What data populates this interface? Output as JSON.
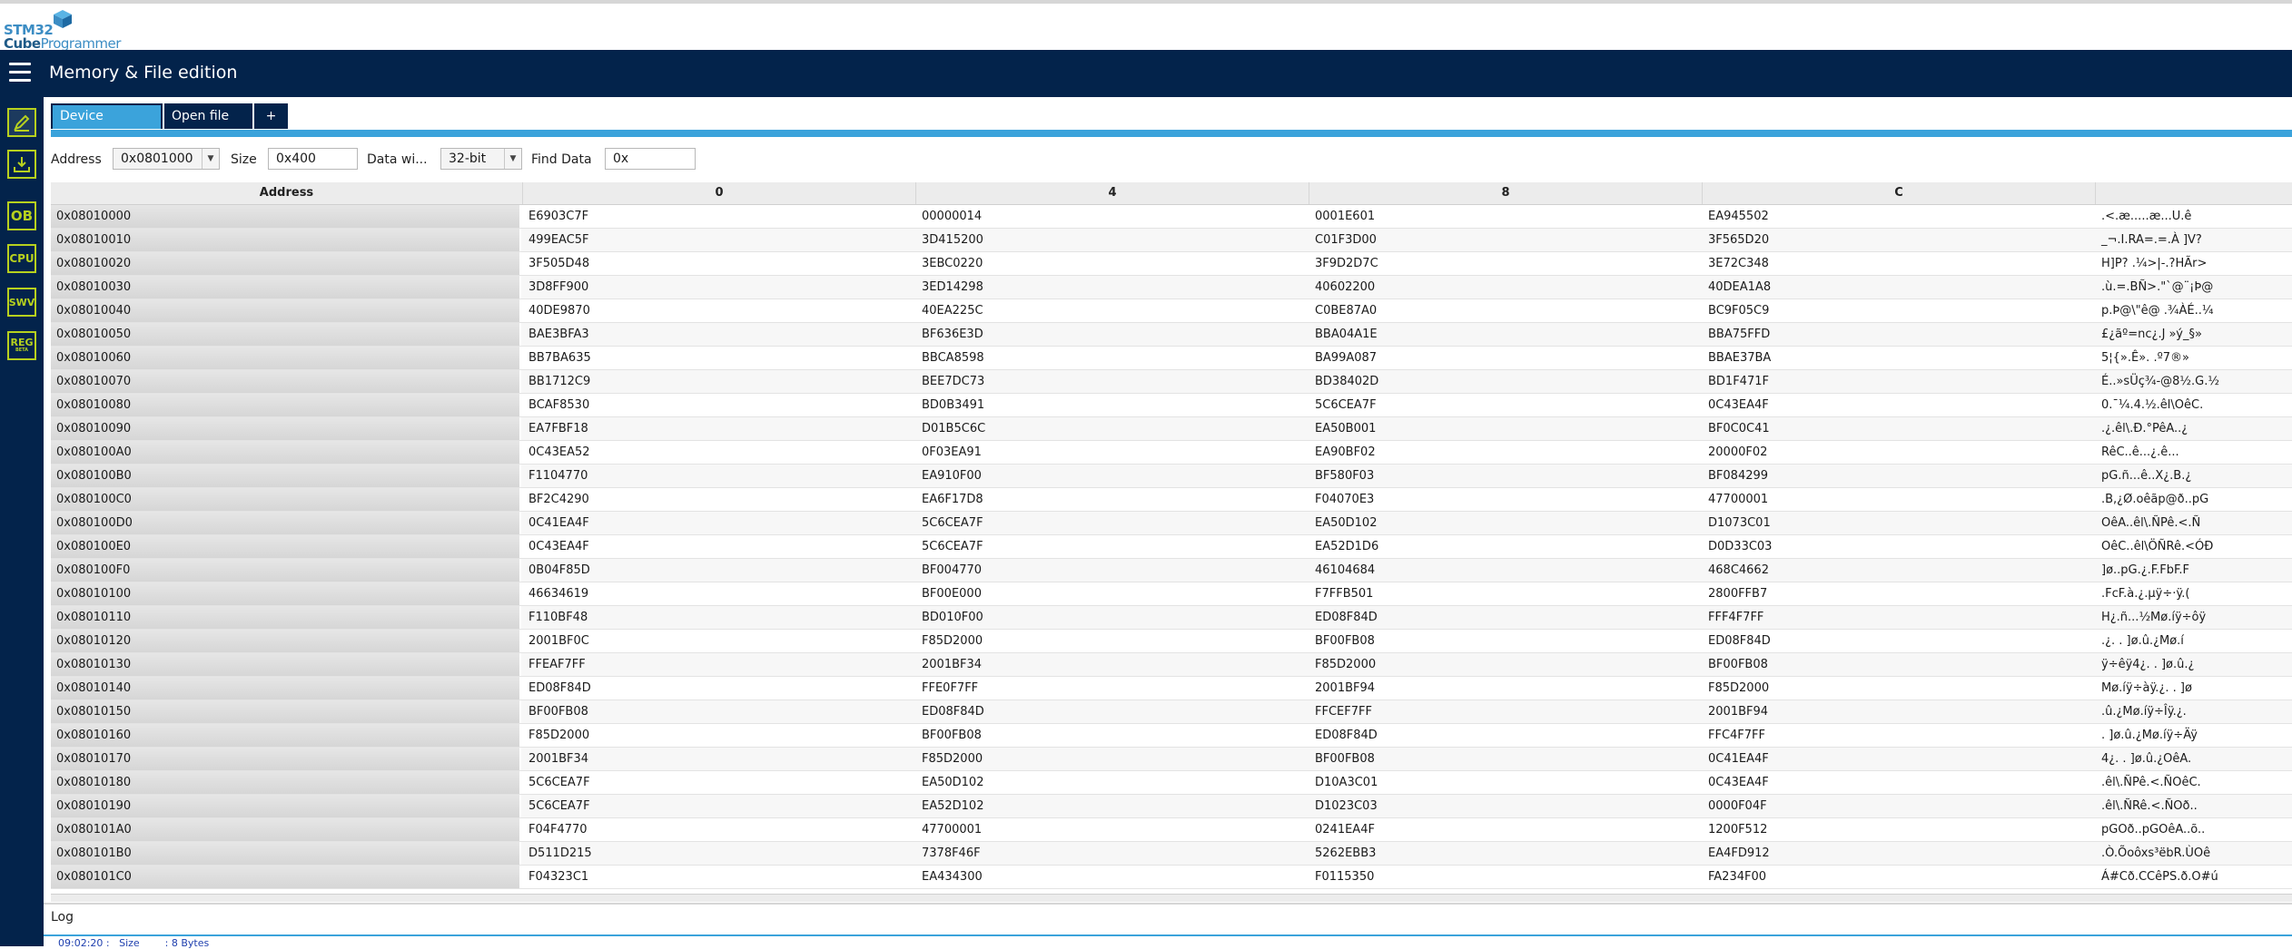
{
  "app": {
    "logo_line1": "STM32",
    "logo_line2_bold": "Cube",
    "logo_line2_rest": "Programmer",
    "page_title": "Memory & File edition"
  },
  "sidebar": [
    {
      "label": "",
      "icon": "pencil-icon"
    },
    {
      "label": "",
      "icon": "download-icon"
    },
    {
      "label": "OB",
      "icon": "option-bytes-icon"
    },
    {
      "label": "CPU",
      "icon": "cpu-icon"
    },
    {
      "label": "SWV",
      "icon": "swv-icon"
    },
    {
      "label": "REG",
      "sub": "BETA",
      "icon": "registers-icon"
    }
  ],
  "tabs": {
    "device_memory": "Device memory",
    "open_file": "Open file",
    "add": "+"
  },
  "toolbar": {
    "address_label": "Address",
    "address_value": "0x0801000",
    "size_label": "Size",
    "size_value": "0x400",
    "data_width_label": "Data wi...",
    "data_width_value": "32-bit",
    "find_label": "Find Data",
    "find_value": "0x"
  },
  "table": {
    "headers": [
      "Address",
      "0",
      "4",
      "8",
      "C",
      ""
    ],
    "rows": [
      [
        "0x08010000",
        "E6903C7F",
        "00000014",
        "0001E601",
        "EA945502",
        ".<.æ.....æ...U.ê"
      ],
      [
        "0x08010010",
        "499EAC5F",
        "3D415200",
        "C01F3D00",
        "3F565D20",
        "_¬.I.RA=.=.À ]V?"
      ],
      [
        "0x08010020",
        "3F505D48",
        "3EBC0220",
        "3F9D2D7C",
        "3E72C348",
        "H]P? .¼>|-.?HÃr>"
      ],
      [
        "0x08010030",
        "3D8FF900",
        "3ED14298",
        "40602200",
        "40DEA1A8",
        ".ù.=.BÑ>.\"`@¨¡Þ@"
      ],
      [
        "0x08010040",
        "40DE9870",
        "40EA225C",
        "C0BE87A0",
        "BC9F05C9",
        "p.Þ@\\\"ê@ .¾ÀÉ..¼"
      ],
      [
        "0x08010050",
        "BAE3BFA3",
        "BF636E3D",
        "BBA04A1E",
        "BBA75FFD",
        "£¿ãº=nc¿.J »ý_§»"
      ],
      [
        "0x08010060",
        "BB7BA635",
        "BBCA8598",
        "BA99A087",
        "BBAE37BA",
        "5¦{».Ê». .º7®»"
      ],
      [
        "0x08010070",
        "BB1712C9",
        "BEE7DC73",
        "BD38402D",
        "BD1F471F",
        "É..»sÜç¾-@8½.G.½"
      ],
      [
        "0x08010080",
        "BCAF8530",
        "BD0B3491",
        "5C6CEA7F",
        "0C43EA4F",
        "0.¯¼.4.½.êl\\OêC."
      ],
      [
        "0x08010090",
        "EA7FBF18",
        "D01B5C6C",
        "EA50B001",
        "BF0C0C41",
        ".¿.êl\\.Ð.°PêA..¿"
      ],
      [
        "0x080100A0",
        "0C43EA52",
        "0F03EA91",
        "EA90BF02",
        "20000F02",
        "RêC..ê...¿.ê..."
      ],
      [
        "0x080100B0",
        "F1104770",
        "EA910F00",
        "BF580F03",
        "BF084299",
        "pG.ñ...ê..X¿.B.¿"
      ],
      [
        "0x080100C0",
        "BF2C4290",
        "EA6F17D8",
        "F04070E3",
        "47700001",
        ".B,¿Ø.oêãp@ð..pG"
      ],
      [
        "0x080100D0",
        "0C41EA4F",
        "5C6CEA7F",
        "EA50D102",
        "D1073C01",
        "OêA..êl\\.ÑPê.<.Ñ"
      ],
      [
        "0x080100E0",
        "0C43EA4F",
        "5C6CEA7F",
        "EA52D1D6",
        "D0D33C03",
        "OêC..êl\\ÖÑRê.<ÓÐ"
      ],
      [
        "0x080100F0",
        "0B04F85D",
        "BF004770",
        "46104684",
        "468C4662",
        "]ø..pG.¿.F.FbF.F"
      ],
      [
        "0x08010100",
        "46634619",
        "BF00E000",
        "F7FFB501",
        "2800FFB7",
        ".FcF.à.¿.µÿ÷·ÿ.("
      ],
      [
        "0x08010110",
        "F110BF48",
        "BD010F00",
        "ED08F84D",
        "FFF4F7FF",
        "H¿.ñ...½Mø.íÿ÷ôÿ"
      ],
      [
        "0x08010120",
        "2001BF0C",
        "F85D2000",
        "BF00FB08",
        "ED08F84D",
        ".¿. . ]ø.û.¿Mø.í"
      ],
      [
        "0x08010130",
        "FFEAF7FF",
        "2001BF34",
        "F85D2000",
        "BF00FB08",
        "ÿ÷êÿ4¿. . ]ø.û.¿"
      ],
      [
        "0x08010140",
        "ED08F84D",
        "FFE0F7FF",
        "2001BF94",
        "F85D2000",
        "Mø.íÿ÷àÿ.¿. . ]ø"
      ],
      [
        "0x08010150",
        "BF00FB08",
        "ED08F84D",
        "FFCEF7FF",
        "2001BF94",
        ".û.¿Mø.íÿ÷Îÿ.¿."
      ],
      [
        "0x08010160",
        "F85D2000",
        "BF00FB08",
        "ED08F84D",
        "FFC4F7FF",
        ". ]ø.û.¿Mø.íÿ÷Äÿ"
      ],
      [
        "0x08010170",
        "2001BF34",
        "F85D2000",
        "BF00FB08",
        "0C41EA4F",
        "4¿. . ]ø.û.¿OêA."
      ],
      [
        "0x08010180",
        "5C6CEA7F",
        "EA50D102",
        "D10A3C01",
        "0C43EA4F",
        ".êl\\.ÑPê.<.ÑOêC."
      ],
      [
        "0x08010190",
        "5C6CEA7F",
        "EA52D102",
        "D1023C03",
        "0000F04F",
        ".êl\\.ÑRê.<.ÑOð.."
      ],
      [
        "0x080101A0",
        "F04F4770",
        "47700001",
        "0241EA4F",
        "1200F512",
        "pGOð..pGOêA..õ.."
      ],
      [
        "0x080101B0",
        "D511D215",
        "7378F46F",
        "5262EBB3",
        "EA4FD912",
        ".Ò.Õoôxs³ëbR.ÙOê"
      ],
      [
        "0x080101C0",
        "F04323C1",
        "EA434300",
        "F0115350",
        "FA234F00",
        "Á#Cð.CCêPS.ð.O#ú"
      ]
    ]
  },
  "log": {
    "label": "Log",
    "line": "09:02:20 :   Size        : 8 Bytes"
  },
  "colors": {
    "navy": "#03234b",
    "accent": "#3ba3db",
    "lime": "#b7d11e"
  }
}
